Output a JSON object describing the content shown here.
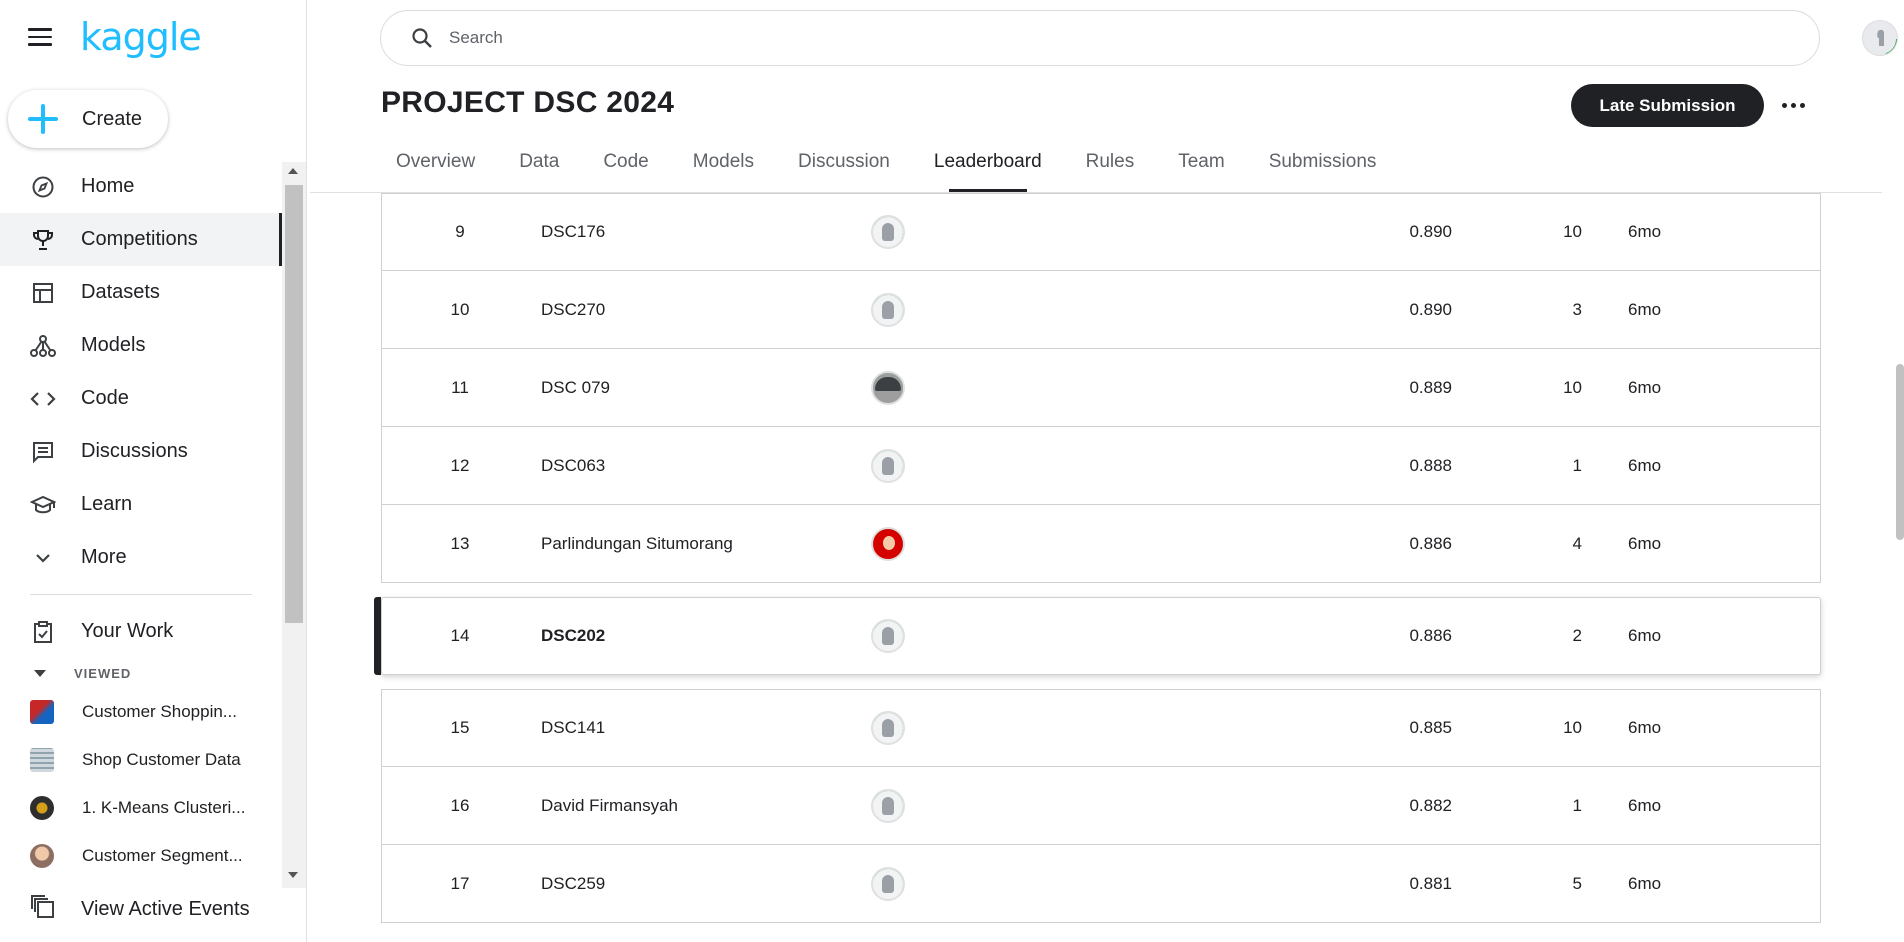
{
  "app": {
    "logo": "kaggle"
  },
  "sidebar": {
    "create_label": "Create",
    "items": [
      {
        "label": "Home",
        "icon": "compass-icon"
      },
      {
        "label": "Competitions",
        "icon": "trophy-icon",
        "active": true
      },
      {
        "label": "Datasets",
        "icon": "table-icon"
      },
      {
        "label": "Models",
        "icon": "models-icon"
      },
      {
        "label": "Code",
        "icon": "code-icon"
      },
      {
        "label": "Discussions",
        "icon": "discussions-icon"
      },
      {
        "label": "Learn",
        "icon": "learn-icon"
      },
      {
        "label": "More",
        "icon": "chevron-down-icon"
      }
    ],
    "your_work": "Your Work",
    "viewed_header": "VIEWED",
    "viewed": [
      {
        "label": "Customer Shoppin...",
        "color": "#c62828"
      },
      {
        "label": "Shop Customer Data",
        "color": "#b0bec5"
      },
      {
        "label": "1. K-Means Clusteri...",
        "color": "#2e2e2e"
      },
      {
        "label": "Customer Segment...",
        "color": "#a1887f"
      }
    ],
    "active_events": "View Active Events"
  },
  "search": {
    "placeholder": "Search"
  },
  "competition": {
    "title": "PROJECT DSC 2024",
    "late_submission": "Late Submission",
    "tabs": [
      "Overview",
      "Data",
      "Code",
      "Models",
      "Discussion",
      "Leaderboard",
      "Rules",
      "Team",
      "Submissions"
    ],
    "active_tab": "Leaderboard"
  },
  "leaderboard": {
    "rows": [
      {
        "rank": "9",
        "team": "DSC176",
        "score": "0.890",
        "entries": "10",
        "last": "6mo",
        "avatar": "default"
      },
      {
        "rank": "10",
        "team": "DSC270",
        "score": "0.890",
        "entries": "3",
        "last": "6mo",
        "avatar": "default"
      },
      {
        "rank": "11",
        "team": "DSC 079",
        "score": "0.889",
        "entries": "10",
        "last": "6mo",
        "avatar": "photo1"
      },
      {
        "rank": "12",
        "team": "DSC063",
        "score": "0.888",
        "entries": "1",
        "last": "6mo",
        "avatar": "default"
      },
      {
        "rank": "13",
        "team": "Parlindungan Situmorang",
        "score": "0.886",
        "entries": "4",
        "last": "6mo",
        "avatar": "photo2"
      },
      {
        "rank": "14",
        "team": "DSC202",
        "score": "0.886",
        "entries": "2",
        "last": "6mo",
        "avatar": "default",
        "highlight": true
      },
      {
        "rank": "15",
        "team": "DSC141",
        "score": "0.885",
        "entries": "10",
        "last": "6mo",
        "avatar": "default"
      },
      {
        "rank": "16",
        "team": "David Firmansyah",
        "score": "0.882",
        "entries": "1",
        "last": "6mo",
        "avatar": "default"
      },
      {
        "rank": "17",
        "team": "DSC259",
        "score": "0.881",
        "entries": "5",
        "last": "6mo",
        "avatar": "default"
      }
    ]
  },
  "colors": {
    "brand": "#20beff",
    "active_ring": "#20a84b",
    "dark": "#202124"
  }
}
